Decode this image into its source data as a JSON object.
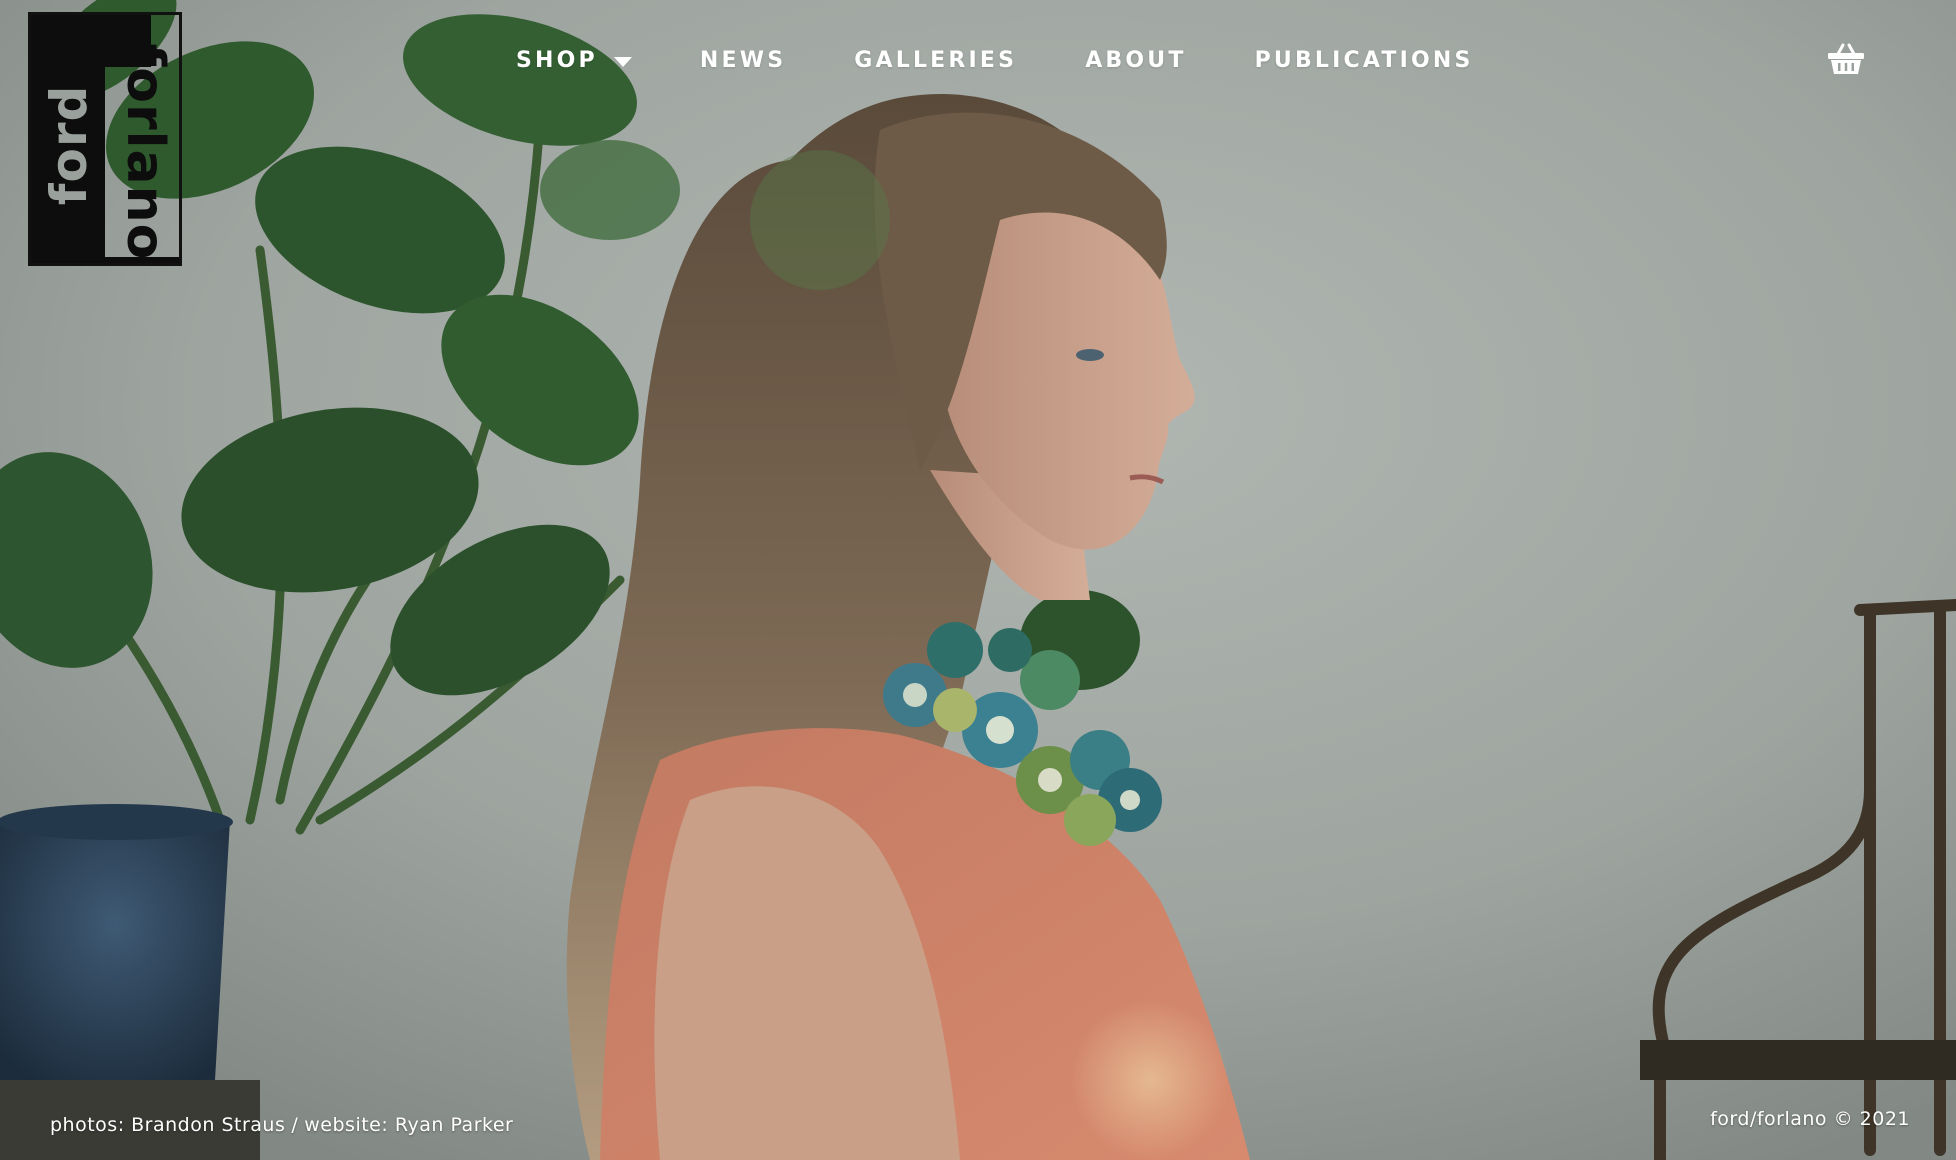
{
  "brand": {
    "logo_word_top": "ford",
    "logo_word_side": "forlano"
  },
  "nav": {
    "items": [
      {
        "label": "SHOP",
        "has_dropdown": true
      },
      {
        "label": "NEWS"
      },
      {
        "label": "GALLERIES"
      },
      {
        "label": "ABOUT"
      },
      {
        "label": "PUBLICATIONS"
      }
    ],
    "cart_icon": "basket-icon"
  },
  "hero": {
    "image": "woman-profile-with-necklace-photo"
  },
  "footer": {
    "photo_credit": "photos: Brandon Straus",
    "separator": "/",
    "site_credit": "website: Ryan Parker",
    "copyright": "ford/forlano © 2021"
  },
  "colors": {
    "nav_text": "#ffffff",
    "logo_black": "#0d0d0d",
    "background": "#9aa19c"
  }
}
